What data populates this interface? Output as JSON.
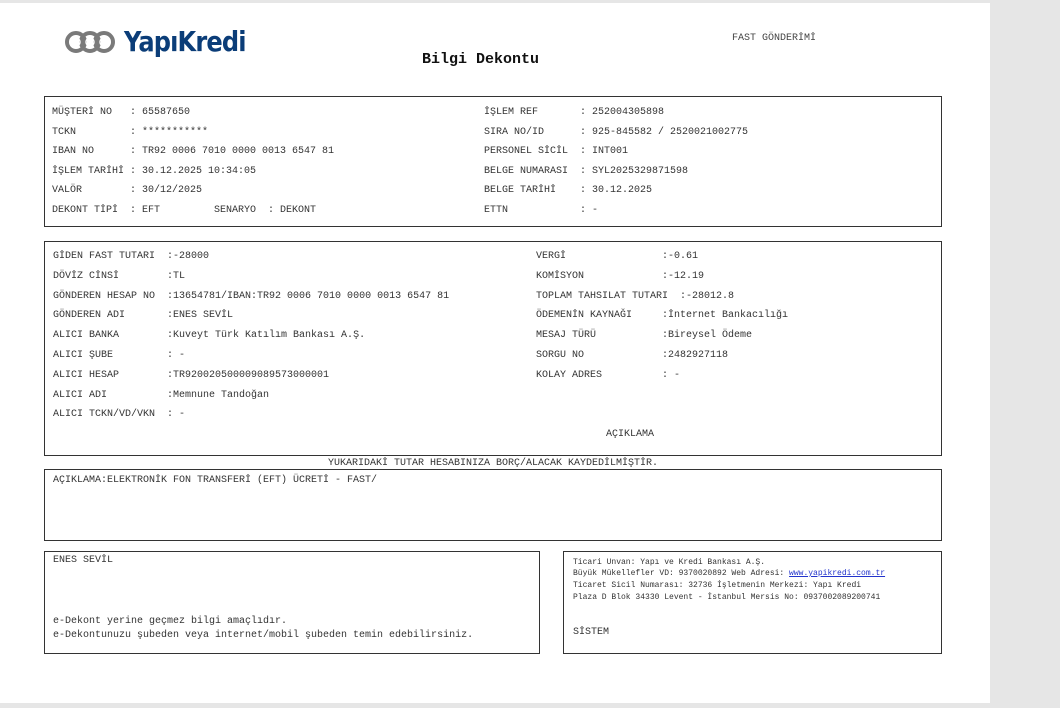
{
  "header": {
    "brand": "YapıKredi",
    "title": "Bilgi Dekontu",
    "doc_type": "FAST GÖNDERİMİ"
  },
  "account": {
    "left": [
      {
        "label": "MÜŞTERİ NO  ",
        "value": ": 65587650"
      },
      {
        "label": "TCKN        ",
        "value": ": ***********"
      },
      {
        "label": "IBAN NO     ",
        "value": ": TR92 0006 7010 0000 0013 6547 81"
      },
      {
        "label": "İŞLEM TARİHİ",
        "value": ": 30.12.2025 10:34:05"
      },
      {
        "label": "VALÖR       ",
        "value": ": 30/12/2025"
      },
      {
        "label": "DEKONT TİPİ ",
        "value": ": EFT         SENARYO  : DEKONT"
      }
    ],
    "right": [
      {
        "label": "İŞLEM REF      ",
        "value": ": 252004305898"
      },
      {
        "label": "SIRA NO/ID     ",
        "value": ": 925-845582 / 2520021002775"
      },
      {
        "label": "PERSONEL SİCİL ",
        "value": ": INT001"
      },
      {
        "label": "BELGE NUMARASI ",
        "value": ": SYL2025329871598"
      },
      {
        "label": "BELGE TARİHİ   ",
        "value": ": 30.12.2025"
      },
      {
        "label": "ETTN           ",
        "value": ": -"
      }
    ]
  },
  "transfer": {
    "left": [
      {
        "label": "GİDEN FAST TUTARI ",
        "value": ":-28000"
      },
      {
        "label": "DÖVİZ CİNSİ       ",
        "value": ":TL"
      },
      {
        "label": "GÖNDEREN HESAP NO ",
        "value": ":13654781/IBAN:TR92 0006 7010 0000 0013 6547 81"
      },
      {
        "label": "GÖNDEREN ADI      ",
        "value": ":ENES SEVİL"
      },
      {
        "label": "ALICI BANKA       ",
        "value": ":Kuveyt Türk Katılım Bankası A.Ş."
      },
      {
        "label": "ALICI ŞUBE        ",
        "value": ": -"
      },
      {
        "label": "ALICI HESAP       ",
        "value": ":TR920020500009089573000001"
      },
      {
        "label": "ALICI ADI         ",
        "value": ":Memnune Tandoğan"
      },
      {
        "label": "ALICI TCKN/VD/VKN ",
        "value": ": -"
      }
    ],
    "right": [
      {
        "label": "VERGİ               ",
        "value": ":-0.61"
      },
      {
        "label": "KOMİSYON            ",
        "value": ":-12.19"
      },
      {
        "label": "TOPLAM TAHSILAT TUTARI ",
        "value": ":-28012.8"
      },
      {
        "label": "ÖDEMENİN KAYNAĞI    ",
        "value": ":İnternet Bankacılığı"
      },
      {
        "label": "MESAJ TÜRÜ          ",
        "value": ":Bireysel Ödeme"
      },
      {
        "label": "SORGU NO            ",
        "value": ":2482927118"
      },
      {
        "label": "KOLAY ADRES         ",
        "value": ": -"
      }
    ],
    "aciklama_label": "AÇIKLAMA"
  },
  "notice": "YUKARIDAKİ TUTAR HESABINIZA BORÇ/ALACAK KAYDEDİLMİŞTİR.",
  "description": "AÇIKLAMA:ELEKTRONİK FON TRANSFERİ (EFT) ÜCRETİ - FAST/",
  "footer_left": {
    "name": "ENES SEVİL",
    "note1": "e-Dekont yerine geçmez bilgi amaçlıdır.",
    "note2": "e-Dekontunuzu şubeden veya internet/mobil şubeden temin edebilirsiniz."
  },
  "footer_right": {
    "line1": "Ticari Unvan: Yapı ve Kredi Bankası A.Ş.",
    "line2_prefix": "Büyük Mükellefler VD: 9370020892 Web Adresi: ",
    "website": "www.yapikredi.com.tr",
    "line3": "Ticaret Sicil Numarası: 32736 İşletmenin Merkezi: Yapı Kredi",
    "line4": "Plaza D Blok 34330 Levent - İstanbul Mersis No: 0937002089200741",
    "signature": "SİSTEM"
  },
  "colors": {
    "brand": "#0b3d78",
    "link": "#2233cc"
  }
}
